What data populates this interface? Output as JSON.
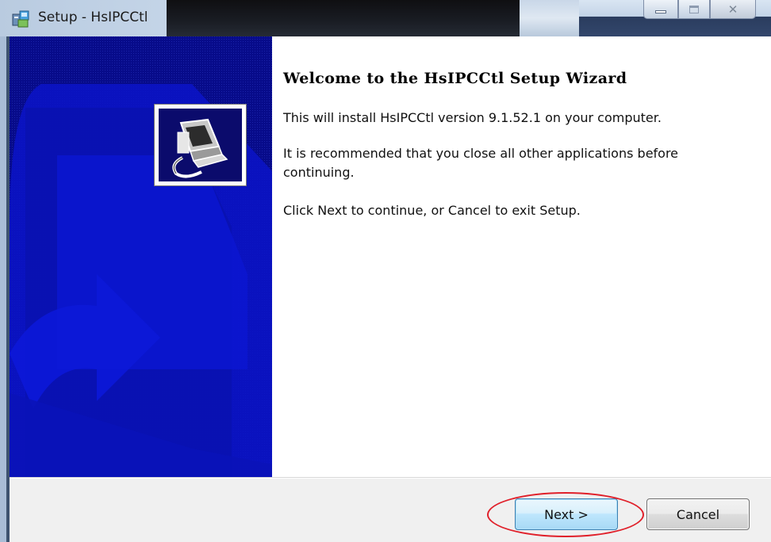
{
  "window": {
    "title": "Setup - HsIPCCtl",
    "icon": "setup-installer-icon",
    "controls": [
      "minimize-icon",
      "maximize-icon",
      "close-icon"
    ]
  },
  "banner": {
    "logo": "computer-install-icon",
    "colors": {
      "background": "#070b8a",
      "shape": "#0a14c8"
    }
  },
  "content": {
    "title": "Welcome to the HsIPCCtl Setup Wizard",
    "paragraphs": [
      "This will install HsIPCCtl version 9.1.52.1 on your computer.",
      "It is recommended that you close all other applications before continuing.",
      "Click Next to continue, or Cancel to exit Setup."
    ]
  },
  "buttons": {
    "next": "Next >",
    "cancel": "Cancel"
  },
  "annotation": {
    "highlight_color": "#e0202a",
    "target": "next"
  }
}
